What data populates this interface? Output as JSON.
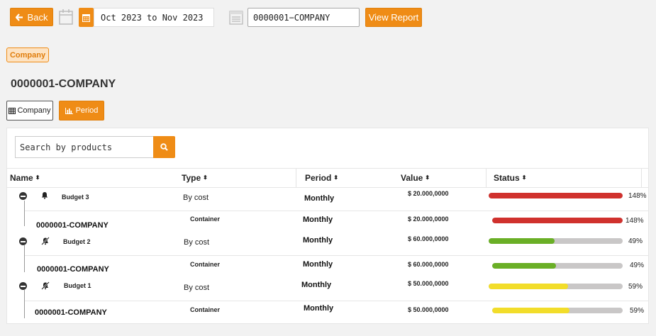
{
  "toolbar": {
    "back_label": "Back",
    "date_range": "Oct 2023 to Nov 2023",
    "company_value": "0000001−COMPANY",
    "view_report_label": "View Report"
  },
  "breadcrumb_chip": "Company",
  "page_title": "0000001-COMPANY",
  "tabs": {
    "company": "Company",
    "period": "Period"
  },
  "search": {
    "placeholder": "Search by products"
  },
  "table": {
    "headers": {
      "name": "Name",
      "type": "Type",
      "period": "Period",
      "value": "Value",
      "status": "Status"
    },
    "rows": [
      {
        "name": "Budget 3",
        "type": "By cost",
        "period": "Monthly",
        "value": "$ 20.000,0000",
        "percent": "148%",
        "fill": 1.0,
        "color": "#d0312d"
      },
      {
        "name": "0000001-COMPANY",
        "type": "Container",
        "period": "Monthly",
        "value": "$ 20.000,0000",
        "percent": "148%",
        "fill": 1.0,
        "color": "#d0312d"
      },
      {
        "name": "Budget 2",
        "type": "By cost",
        "period": "Monthly",
        "value": "$ 60.000,0000",
        "percent": "49%",
        "fill": 0.49,
        "color": "#6aaf26"
      },
      {
        "name": "0000001-COMPANY",
        "type": "Container",
        "period": "Monthly",
        "value": "$ 60.000,0000",
        "percent": "49%",
        "fill": 0.49,
        "color": "#6aaf26"
      },
      {
        "name": "Budget 1",
        "type": "By cost",
        "period": "Monthly",
        "value": "$ 50.000,0000",
        "percent": "59%",
        "fill": 0.59,
        "color": "#f2dd2a"
      },
      {
        "name": "0000001-COMPANY",
        "type": "Container",
        "period": "Monthly",
        "value": "$ 50.000,0000",
        "percent": "59%",
        "fill": 0.59,
        "color": "#f2dd2a"
      }
    ]
  },
  "colors": {
    "accent": "#ef8c16"
  }
}
